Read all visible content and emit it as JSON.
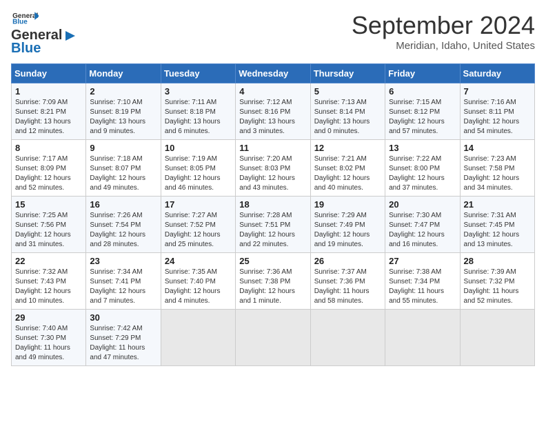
{
  "header": {
    "logo_line1": "General",
    "logo_line2": "Blue",
    "month": "September 2024",
    "location": "Meridian, Idaho, United States"
  },
  "days_of_week": [
    "Sunday",
    "Monday",
    "Tuesday",
    "Wednesday",
    "Thursday",
    "Friday",
    "Saturday"
  ],
  "weeks": [
    [
      {
        "day": 1,
        "sunrise": "Sunrise: 7:09 AM",
        "sunset": "Sunset: 8:21 PM",
        "daylight": "Daylight: 13 hours and 12 minutes."
      },
      {
        "day": 2,
        "sunrise": "Sunrise: 7:10 AM",
        "sunset": "Sunset: 8:19 PM",
        "daylight": "Daylight: 13 hours and 9 minutes."
      },
      {
        "day": 3,
        "sunrise": "Sunrise: 7:11 AM",
        "sunset": "Sunset: 8:18 PM",
        "daylight": "Daylight: 13 hours and 6 minutes."
      },
      {
        "day": 4,
        "sunrise": "Sunrise: 7:12 AM",
        "sunset": "Sunset: 8:16 PM",
        "daylight": "Daylight: 13 hours and 3 minutes."
      },
      {
        "day": 5,
        "sunrise": "Sunrise: 7:13 AM",
        "sunset": "Sunset: 8:14 PM",
        "daylight": "Daylight: 13 hours and 0 minutes."
      },
      {
        "day": 6,
        "sunrise": "Sunrise: 7:15 AM",
        "sunset": "Sunset: 8:12 PM",
        "daylight": "Daylight: 12 hours and 57 minutes."
      },
      {
        "day": 7,
        "sunrise": "Sunrise: 7:16 AM",
        "sunset": "Sunset: 8:11 PM",
        "daylight": "Daylight: 12 hours and 54 minutes."
      }
    ],
    [
      {
        "day": 8,
        "sunrise": "Sunrise: 7:17 AM",
        "sunset": "Sunset: 8:09 PM",
        "daylight": "Daylight: 12 hours and 52 minutes."
      },
      {
        "day": 9,
        "sunrise": "Sunrise: 7:18 AM",
        "sunset": "Sunset: 8:07 PM",
        "daylight": "Daylight: 12 hours and 49 minutes."
      },
      {
        "day": 10,
        "sunrise": "Sunrise: 7:19 AM",
        "sunset": "Sunset: 8:05 PM",
        "daylight": "Daylight: 12 hours and 46 minutes."
      },
      {
        "day": 11,
        "sunrise": "Sunrise: 7:20 AM",
        "sunset": "Sunset: 8:03 PM",
        "daylight": "Daylight: 12 hours and 43 minutes."
      },
      {
        "day": 12,
        "sunrise": "Sunrise: 7:21 AM",
        "sunset": "Sunset: 8:02 PM",
        "daylight": "Daylight: 12 hours and 40 minutes."
      },
      {
        "day": 13,
        "sunrise": "Sunrise: 7:22 AM",
        "sunset": "Sunset: 8:00 PM",
        "daylight": "Daylight: 12 hours and 37 minutes."
      },
      {
        "day": 14,
        "sunrise": "Sunrise: 7:23 AM",
        "sunset": "Sunset: 7:58 PM",
        "daylight": "Daylight: 12 hours and 34 minutes."
      }
    ],
    [
      {
        "day": 15,
        "sunrise": "Sunrise: 7:25 AM",
        "sunset": "Sunset: 7:56 PM",
        "daylight": "Daylight: 12 hours and 31 minutes."
      },
      {
        "day": 16,
        "sunrise": "Sunrise: 7:26 AM",
        "sunset": "Sunset: 7:54 PM",
        "daylight": "Daylight: 12 hours and 28 minutes."
      },
      {
        "day": 17,
        "sunrise": "Sunrise: 7:27 AM",
        "sunset": "Sunset: 7:52 PM",
        "daylight": "Daylight: 12 hours and 25 minutes."
      },
      {
        "day": 18,
        "sunrise": "Sunrise: 7:28 AM",
        "sunset": "Sunset: 7:51 PM",
        "daylight": "Daylight: 12 hours and 22 minutes."
      },
      {
        "day": 19,
        "sunrise": "Sunrise: 7:29 AM",
        "sunset": "Sunset: 7:49 PM",
        "daylight": "Daylight: 12 hours and 19 minutes."
      },
      {
        "day": 20,
        "sunrise": "Sunrise: 7:30 AM",
        "sunset": "Sunset: 7:47 PM",
        "daylight": "Daylight: 12 hours and 16 minutes."
      },
      {
        "day": 21,
        "sunrise": "Sunrise: 7:31 AM",
        "sunset": "Sunset: 7:45 PM",
        "daylight": "Daylight: 12 hours and 13 minutes."
      }
    ],
    [
      {
        "day": 22,
        "sunrise": "Sunrise: 7:32 AM",
        "sunset": "Sunset: 7:43 PM",
        "daylight": "Daylight: 12 hours and 10 minutes."
      },
      {
        "day": 23,
        "sunrise": "Sunrise: 7:34 AM",
        "sunset": "Sunset: 7:41 PM",
        "daylight": "Daylight: 12 hours and 7 minutes."
      },
      {
        "day": 24,
        "sunrise": "Sunrise: 7:35 AM",
        "sunset": "Sunset: 7:40 PM",
        "daylight": "Daylight: 12 hours and 4 minutes."
      },
      {
        "day": 25,
        "sunrise": "Sunrise: 7:36 AM",
        "sunset": "Sunset: 7:38 PM",
        "daylight": "Daylight: 12 hours and 1 minute."
      },
      {
        "day": 26,
        "sunrise": "Sunrise: 7:37 AM",
        "sunset": "Sunset: 7:36 PM",
        "daylight": "Daylight: 11 hours and 58 minutes."
      },
      {
        "day": 27,
        "sunrise": "Sunrise: 7:38 AM",
        "sunset": "Sunset: 7:34 PM",
        "daylight": "Daylight: 11 hours and 55 minutes."
      },
      {
        "day": 28,
        "sunrise": "Sunrise: 7:39 AM",
        "sunset": "Sunset: 7:32 PM",
        "daylight": "Daylight: 11 hours and 52 minutes."
      }
    ],
    [
      {
        "day": 29,
        "sunrise": "Sunrise: 7:40 AM",
        "sunset": "Sunset: 7:30 PM",
        "daylight": "Daylight: 11 hours and 49 minutes."
      },
      {
        "day": 30,
        "sunrise": "Sunrise: 7:42 AM",
        "sunset": "Sunset: 7:29 PM",
        "daylight": "Daylight: 11 hours and 47 minutes."
      },
      null,
      null,
      null,
      null,
      null
    ]
  ]
}
